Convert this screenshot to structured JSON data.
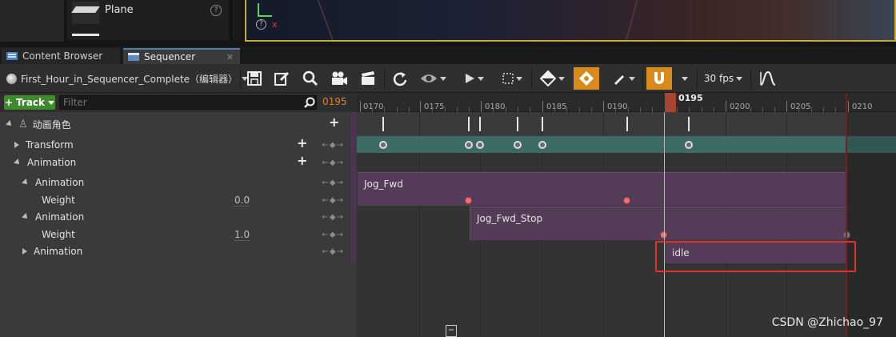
{
  "content_browser_preview": {
    "item_label": "Plane",
    "help_glyph": "?"
  },
  "viewport": {
    "axis_x_label": "x",
    "help_glyph": "?"
  },
  "tabs": [
    {
      "label": "Content Browser",
      "icon": "folder-icon",
      "active": false
    },
    {
      "label": "Sequencer",
      "icon": "sequencer-icon",
      "active": true
    }
  ],
  "toolbar": {
    "sequence_name": "First_Hour_in_Sequencer_Complete（编辑器）",
    "fps_label": "30 fps",
    "icons": [
      "save-icon",
      "edit-icon",
      "search-icon",
      "camera-icon",
      "clapper-icon",
      "refresh-icon",
      "eye-icon",
      "play-icon",
      "select-icon",
      "key-icon",
      "bookmark-icon",
      "pen-icon",
      "magnet-icon",
      "curve-icon"
    ],
    "accent_color": "#d98a1c"
  },
  "outliner": {
    "add_track_label": "Track",
    "filter_placeholder": "Filter",
    "current_frame": "0195",
    "rows": [
      {
        "label": "动画角色",
        "type": "actor"
      },
      {
        "label": "Transform",
        "type": "track"
      },
      {
        "label": "Animation",
        "type": "track"
      },
      {
        "label": "Animation",
        "type": "subtrack"
      },
      {
        "label": "Weight",
        "type": "param",
        "value": "0.0"
      },
      {
        "label": "Animation",
        "type": "subtrack"
      },
      {
        "label": "Weight",
        "type": "param",
        "value": "1.0"
      },
      {
        "label": "Animation",
        "type": "subtrack"
      }
    ]
  },
  "timeline": {
    "tick_labels": [
      "0170",
      "0175",
      "0180",
      "0185",
      "0190",
      "0200",
      "0205",
      "0210"
    ],
    "playhead_frame": "0195",
    "sections": [
      {
        "label": "Jog_Fwd"
      },
      {
        "label": "Jog_Fwd_Stop"
      },
      {
        "label": "idle"
      }
    ],
    "section_color": "#543b58",
    "transform_track_color": "#3c6b66",
    "highlight_color": "#e0332a"
  },
  "watermark": "CSDN @Zhichao_97"
}
